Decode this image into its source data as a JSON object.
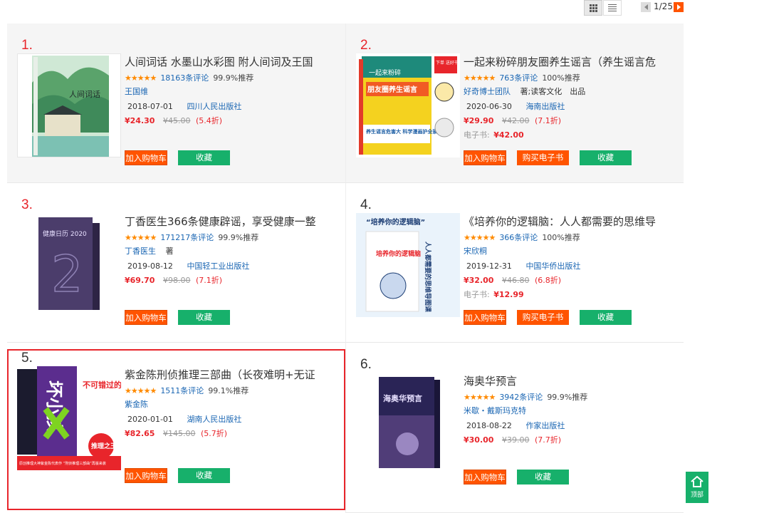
{
  "toolbar": {
    "pager": "1/25",
    "grid_icon": "grid-view-icon",
    "list_icon": "list-view-icon"
  },
  "items": [
    {
      "rank": "1.",
      "title": "人间词话 水墨山水彩图 附人间词及王国",
      "reviews": "18163条评论",
      "recommend": "99.9%推荐",
      "author": "王国维",
      "author_suffix": "",
      "date": "2018-07-01",
      "publisher": "四川人民出版社",
      "price": "¥24.30",
      "orig": "¥45.00",
      "disc": "(5.4折)",
      "ebook_label": "",
      "ebook_price": "",
      "cover": {
        "main": "人间词话"
      }
    },
    {
      "rank": "2.",
      "title": "一起来粉碎朋友圈养生谣言（养生谣言危",
      "reviews": "763条评论",
      "recommend": "100%推荐",
      "author": "好奇博士团队",
      "author_suffix": "著;读客文化　出品",
      "date": "2020-06-30",
      "publisher": "海南出版社",
      "price": "¥29.90",
      "orig": "¥42.00",
      "disc": "(7.1折)",
      "ebook_label": "电子书:",
      "ebook_price": "¥42.00",
      "cover": {
        "line1": "一起来粉碎",
        "line2": "朋友圈养生谣言",
        "badge": "下单 送好书",
        "bottom": "养生谣言危害大 科学漫画护全家"
      }
    },
    {
      "rank": "3.",
      "title": "丁香医生366条健康辟谣，享受健康一整",
      "reviews": "171217条评论",
      "recommend": "99.9%推荐",
      "author": "丁香医生",
      "author_suffix": "著",
      "date": "2019-08-12",
      "publisher": "中国轻工业出版社",
      "price": "¥69.70",
      "orig": "¥98.00",
      "disc": "(7.1折)",
      "ebook_label": "",
      "ebook_price": "",
      "cover": {
        "main": "健康日历 2020",
        "digits": "2"
      }
    },
    {
      "rank": "4.",
      "title": "《培养你的逻辑脑：人人都需要的思维导",
      "reviews": "366条评论",
      "recommend": "100%推荐",
      "author": "宋欣桐",
      "author_suffix": "",
      "date": "2019-12-31",
      "publisher": "中国华侨出版社",
      "price": "¥32.00",
      "orig": "¥46.80",
      "disc": "(6.8折)",
      "ebook_label": "电子书:",
      "ebook_price": "¥12.99",
      "cover": {
        "top": "“培养你的逻辑脑”",
        "side": "人人都需要的思维导图课",
        "book": "培养你的逻辑脑"
      }
    },
    {
      "rank": "5.",
      "title": "紫金陈刑侦推理三部曲（长夜难明+无证",
      "reviews": "1511条评论",
      "recommend": "99.1%推荐",
      "author": "紫金陈",
      "author_suffix": "",
      "date": "2020-01-01",
      "publisher": "湖南人民出版社",
      "price": "¥82.65",
      "orig": "¥145.00",
      "disc": "(5.7折)",
      "ebook_label": "",
      "ebook_price": "",
      "cover": {
        "main": "坏小孩",
        "side": "不可错过的",
        "badge": "推理之王",
        "bottom": "原创推理大神紫金陈代表作 “刑侦推理三部曲”再版来袭"
      }
    },
    {
      "rank": "6.",
      "title": "海奥华预言",
      "reviews": "3942条评论",
      "recommend": "99.9%推荐",
      "author": "米歇・戴斯玛克特",
      "author_suffix": "",
      "date": "2018-08-22",
      "publisher": "作家出版社",
      "price": "¥30.00",
      "orig": "¥39.00",
      "disc": "(7.7折)",
      "ebook_label": "",
      "ebook_price": "",
      "cover": {
        "main": "海奥华预言"
      }
    }
  ],
  "buttons": {
    "cart": "加入购物车",
    "fav": "收藏",
    "ebook": "购买电子书"
  },
  "stars": "★★★★★",
  "backtop": {
    "label": "顶部",
    "icon": "home-up-icon"
  },
  "colors": {
    "accent": "#ff5400",
    "green": "#17b06b",
    "rank_red": "#e8252b",
    "link": "#1a66b3"
  }
}
